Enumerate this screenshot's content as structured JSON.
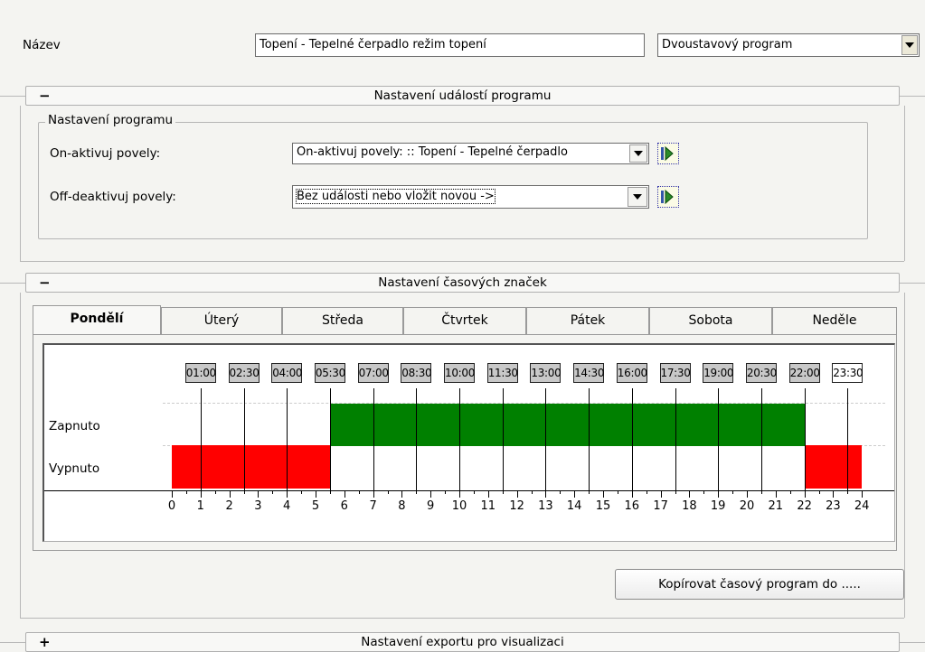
{
  "name_label": "Název",
  "name_value": "Topení - Tepelné čerpadlo režim topení",
  "program_type": "Dvoustavový program",
  "events_section": {
    "sign": "−",
    "title": "Nastavení událostí programu"
  },
  "program_group": {
    "title": "Nastavení programu",
    "on_label": "On-aktivuj povely:",
    "on_value": "On-aktivuj povely: :: Topení - Tepelné čerpadlo",
    "off_label": "Off-deaktivuj povely:",
    "off_value": "Bez události nebo vložit novou ->"
  },
  "time_section": {
    "sign": "−",
    "title": "Nastavení časových značek"
  },
  "days": [
    "Pondělí",
    "Úterý",
    "Středa",
    "Čtvrtek",
    "Pátek",
    "Sobota",
    "Neděle"
  ],
  "active_day": "Pondělí",
  "timeline": {
    "row_on": "Zapnuto",
    "row_off": "Vypnuto",
    "marks": [
      "01:00",
      "02:30",
      "04:00",
      "05:30",
      "07:00",
      "08:30",
      "10:00",
      "11:30",
      "13:00",
      "14:30",
      "16:00",
      "17:30",
      "19:00",
      "20:30",
      "22:00",
      "23:30"
    ],
    "mark_hours": [
      1,
      2.5,
      4,
      5.5,
      7,
      8.5,
      10,
      11.5,
      13,
      14.5,
      16,
      17.5,
      19,
      20.5,
      22,
      23.5
    ],
    "axis_ticks": [
      "0",
      "1",
      "2",
      "3",
      "4",
      "5",
      "6",
      "7",
      "8",
      "9",
      "10",
      "11",
      "12",
      "13",
      "14",
      "15",
      "16",
      "17",
      "18",
      "19",
      "20",
      "21",
      "22",
      "23",
      "24"
    ],
    "on_intervals": [
      [
        5.5,
        22
      ]
    ],
    "off_intervals": [
      [
        0,
        5.5
      ],
      [
        22,
        24
      ]
    ],
    "on_color": "#008000",
    "off_color": "#ff0000"
  },
  "copy_button": "Kopírovat časový program do .....",
  "export_section": {
    "sign": "+",
    "title": "Nastavení exportu pro visualizaci"
  }
}
